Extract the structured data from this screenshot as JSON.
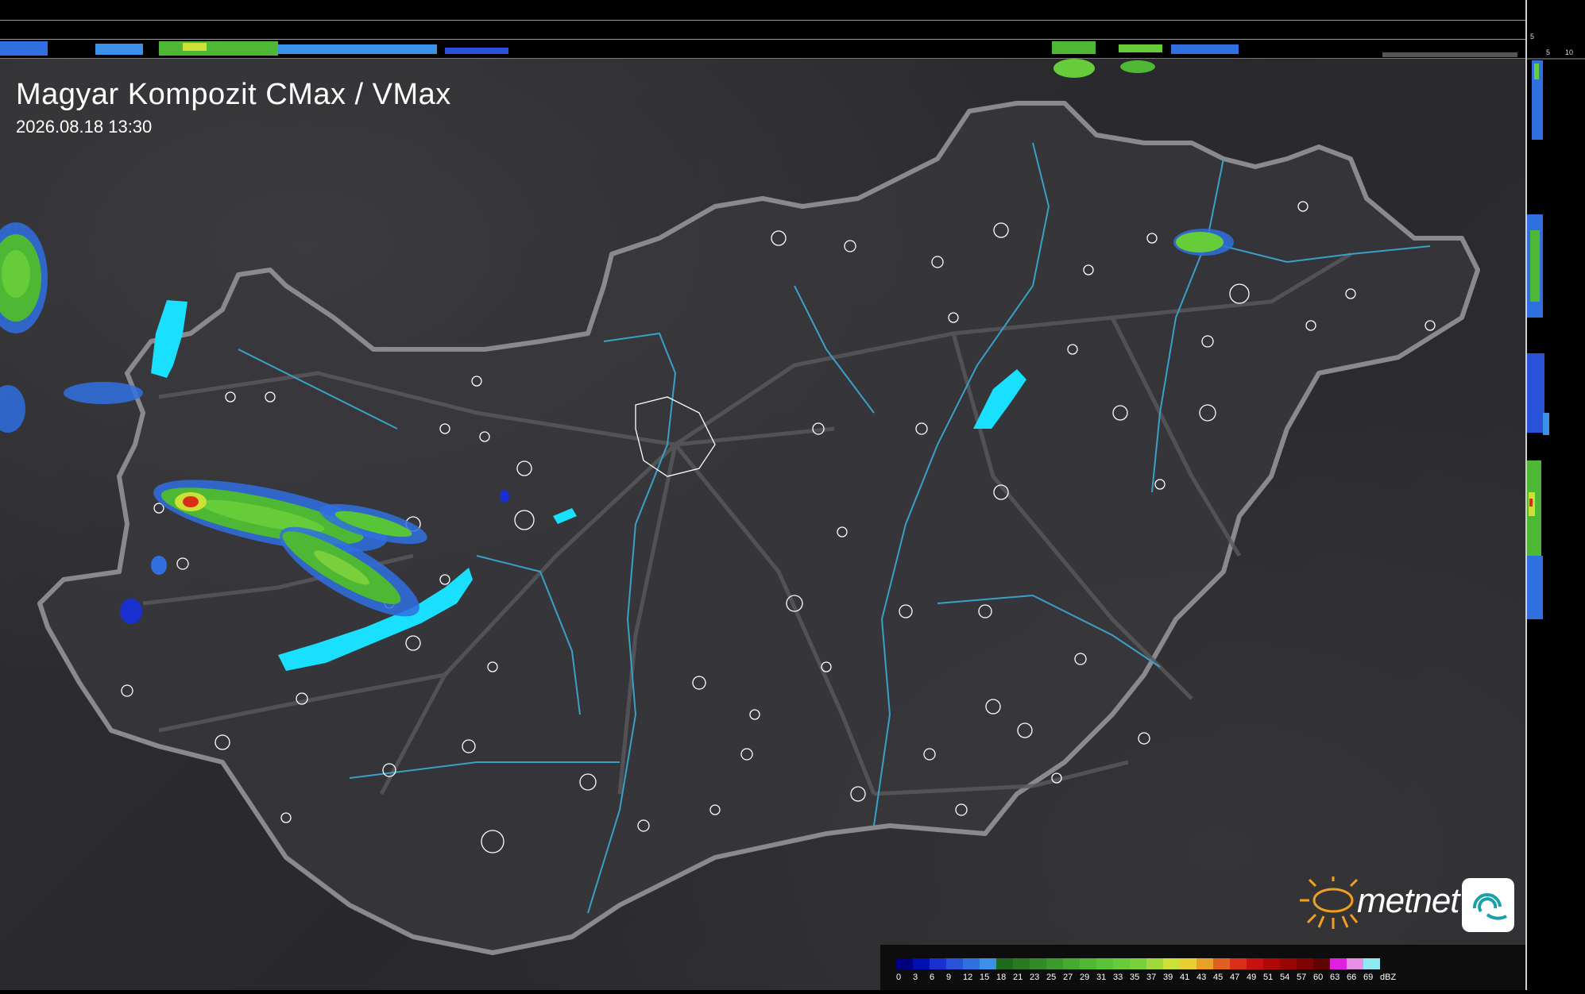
{
  "map": {
    "title": "Magyar Kompozit CMax / VMax",
    "datetime": "2026.08.18 13:30"
  },
  "side_scale": {
    "top_labels": [
      "10",
      "5"
    ],
    "bottom_labels": [
      "5",
      "10"
    ]
  },
  "legend": {
    "unit": "dBZ",
    "labels": [
      "0",
      "3",
      "6",
      "9",
      "12",
      "15",
      "18",
      "21",
      "23",
      "25",
      "27",
      "29",
      "31",
      "33",
      "35",
      "37",
      "39",
      "41",
      "43",
      "45",
      "47",
      "49",
      "51",
      "54",
      "57",
      "60",
      "63",
      "66",
      "69"
    ],
    "colors": [
      "#000080",
      "#0010b0",
      "#1a2fd0",
      "#2a52d8",
      "#3070e0",
      "#3b90e8",
      "#1e6a1e",
      "#2a7a22",
      "#338a28",
      "#3c9a2c",
      "#45aa30",
      "#4eb834",
      "#58c438",
      "#66cc3a",
      "#7ad03a",
      "#a0d83a",
      "#cce038",
      "#e8d030",
      "#e8a028",
      "#e06020",
      "#d83018",
      "#c81010",
      "#b00808",
      "#980606",
      "#800404",
      "#600202",
      "#e020e0",
      "#e890e8",
      "#90e8f0"
    ]
  },
  "logo": {
    "brand": "metnet"
  }
}
